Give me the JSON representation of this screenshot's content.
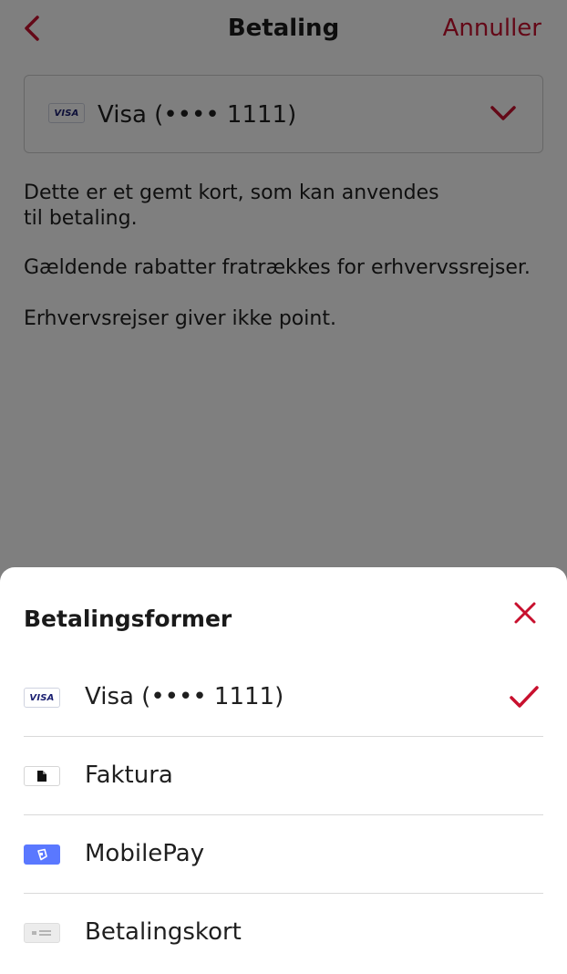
{
  "header": {
    "title": "Betaling",
    "cancel_label": "Annuller"
  },
  "selected_card": {
    "brand_badge": "VISA",
    "label": "Visa (•••• 1111)"
  },
  "info": {
    "line1": "Dette er et gemt kort, som kan anvendes til betaling.",
    "line2": "Gældende rabatter fratrækkes for erhvervssrejser.",
    "line3": "Erhvervsrejser giver ikke point."
  },
  "sheet": {
    "title": "Betalingsformer",
    "options": [
      {
        "label": "Visa (•••• 1111)",
        "icon": "visa-card-icon",
        "badge": "VISA",
        "selected": true
      },
      {
        "label": "Faktura",
        "icon": "document-icon",
        "selected": false
      },
      {
        "label": "MobilePay",
        "icon": "mobilepay-icon",
        "selected": false
      },
      {
        "label": "Betalingskort",
        "icon": "generic-card-icon",
        "selected": false
      }
    ]
  },
  "colors": {
    "accent": "#c8102e",
    "overlay": "rgba(0,0,0,0.5)",
    "mobilepay": "#5a78ff"
  }
}
